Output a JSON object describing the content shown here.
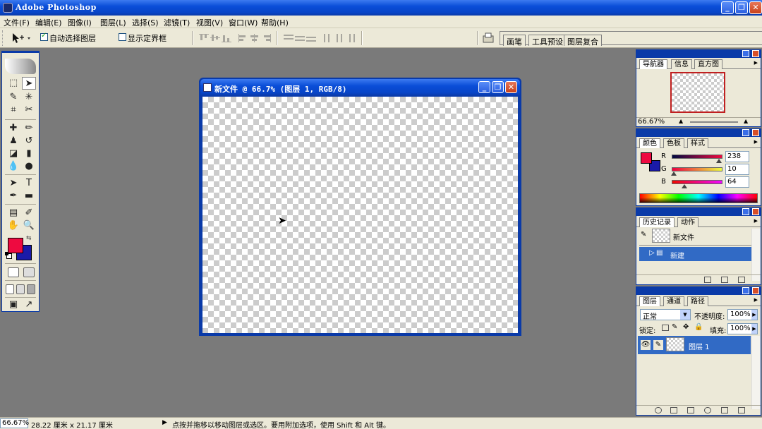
{
  "app": {
    "title": "Adobe Photoshop"
  },
  "menu": {
    "items": [
      "文件(F)",
      "编辑(E)",
      "图像(I)",
      "图层(L)",
      "选择(S)",
      "滤镜(T)",
      "视图(V)",
      "窗口(W)",
      "帮助(H)"
    ]
  },
  "options": {
    "auto_select_label": "自动选择图层",
    "auto_select_checked": true,
    "show_bounds_label": "显示定界框",
    "show_bounds_checked": false
  },
  "palette_well": {
    "tabs": [
      "画笔",
      "工具预设",
      "图层复合"
    ]
  },
  "colors": {
    "foreground": "#EE0A40",
    "background": "#1A1AA8",
    "accent": "#0A3AA8"
  },
  "document": {
    "title": "新文件 @ 66.7% (图层 1, RGB/8)"
  },
  "navigator": {
    "tabs": [
      "导航器",
      "信息",
      "直方图"
    ],
    "zoom": "66.67%"
  },
  "color_palette": {
    "tabs": [
      "颜色",
      "色板",
      "样式"
    ],
    "r_label": "R",
    "r_value": "238",
    "g_label": "G",
    "g_value": "10",
    "b_label": "B",
    "b_value": "64"
  },
  "history": {
    "tabs": [
      "历史记录",
      "动作"
    ],
    "snapshot_label": "新文件",
    "items": [
      "新建"
    ]
  },
  "layers": {
    "tabs": [
      "图层",
      "通道",
      "路径"
    ],
    "blend_mode": "正常",
    "opacity_label": "不透明度:",
    "opacity_value": "100%",
    "lock_label": "锁定:",
    "fill_label": "填充:",
    "fill_value": "100%",
    "layer_names": [
      "图层 1"
    ]
  },
  "status": {
    "zoom": "66.67%",
    "doc_size": "28.22 厘米 x 21.17 厘米",
    "hint": "点按并拖移以移动图层或选区。要用附加选项，使用 Shift 和 Alt 键。"
  },
  "icons": {
    "move_tool": "move-icon",
    "eye": "eye-icon",
    "brush": "brush-icon"
  }
}
